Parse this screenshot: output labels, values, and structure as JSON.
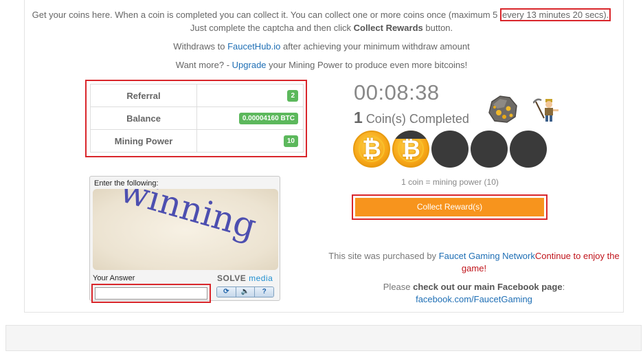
{
  "intro": {
    "line1_before": "Get your coins here. When a coin is completed you can collect it. You can collect one or more coins once (maximum 5",
    "line1_highlight": "every 13 minutes 20 secs).",
    "line2_before": "Just complete the captcha and then click",
    "line2_bold": "Collect Rewards",
    "line2_after": "button.",
    "line3_before": "Withdraws to",
    "line3_link": "FaucetHub.io",
    "line3_after": "after achieving your minimum withdraw amount",
    "line4_before": "Want more? -",
    "line4_link": "Upgrade",
    "line4_after": "your Mining Power to produce even more bitcoins!"
  },
  "stats": [
    {
      "label": "Referral",
      "value": "2"
    },
    {
      "label": "Balance",
      "value": "0.00004160 BTC"
    },
    {
      "label": "Mining Power",
      "value": "10"
    }
  ],
  "mining": {
    "timer": "00:08:38",
    "completed_count": "1",
    "completed_label": "Coin(s) Completed",
    "coins_total": 5,
    "coins_completed": 1,
    "coin_in_progress_fraction": 0.78,
    "coin_symbol": "₿",
    "coin_rate": "1 coin = mining power (10)",
    "collect_button": "Collect Reward(s)"
  },
  "notice": {
    "purchase_before": "This site was purchased by",
    "purchase_link": "Faucet Gaming Network",
    "purchase_after": "Continue to enjoy the game!",
    "fb_before": "Please",
    "fb_bold": "check out our main Facebook page",
    "fb_after": ":",
    "fb_link": "facebook.com/FaucetGaming"
  },
  "captcha": {
    "title": "Enter the following:",
    "word": "winning",
    "answer_label": "Your Answer",
    "answer_value": "",
    "brand_solve": "SOLVE",
    "brand_media": "media",
    "buttons": [
      "⟳",
      "🔈",
      "?"
    ]
  },
  "colors": {
    "accent_red": "#d9262b",
    "button_orange": "#f7941d",
    "badge_green": "#5cb85c",
    "link_blue": "#1f6fb5",
    "coin_gold": "#f6a516"
  }
}
